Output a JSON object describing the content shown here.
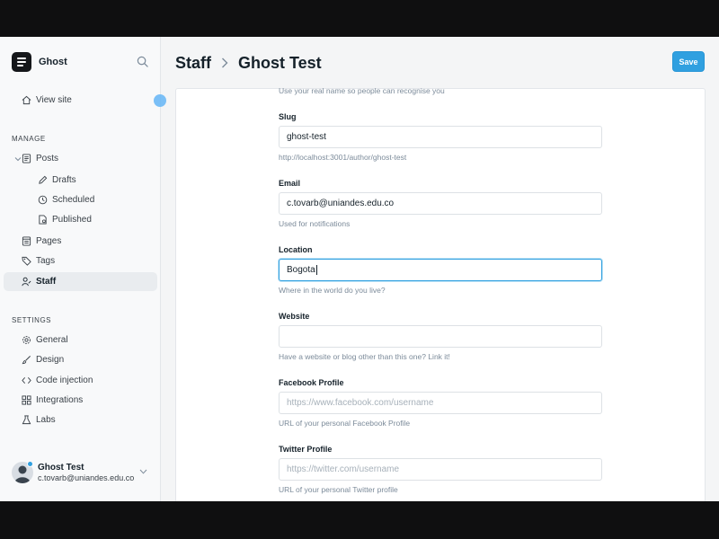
{
  "sidebar": {
    "brand": "Ghost",
    "view_site": "View site",
    "manage_heading": "MANAGE",
    "posts": "Posts",
    "drafts": "Drafts",
    "scheduled": "Scheduled",
    "published": "Published",
    "pages": "Pages",
    "tags": "Tags",
    "staff": "Staff",
    "settings_heading": "SETTINGS",
    "general": "General",
    "design": "Design",
    "code_injection": "Code injection",
    "integrations": "Integrations",
    "labs": "Labs",
    "user": {
      "name": "Ghost Test",
      "email": "c.tovarb@uniandes.edu.co"
    }
  },
  "header": {
    "breadcrumb_parent": "Staff",
    "breadcrumb_current": "Ghost Test",
    "save_label": "Save"
  },
  "form": {
    "name_hint": "Use your real name so people can recognise you",
    "slug": {
      "label": "Slug",
      "value": "ghost-test",
      "hint": "http://localhost:3001/author/ghost-test"
    },
    "email": {
      "label": "Email",
      "value": "c.tovarb@uniandes.edu.co",
      "hint": "Used for notifications"
    },
    "location": {
      "label": "Location",
      "value": "Bogota",
      "hint": "Where in the world do you live?"
    },
    "website": {
      "label": "Website",
      "value": "",
      "hint": "Have a website or blog other than this one? Link it!"
    },
    "facebook": {
      "label": "Facebook Profile",
      "placeholder": "https://www.facebook.com/username",
      "hint": "URL of your personal Facebook Profile"
    },
    "twitter": {
      "label": "Twitter Profile",
      "placeholder": "https://twitter.com/username",
      "hint": "URL of your personal Twitter profile"
    }
  },
  "colors": {
    "accent": "#30a0e0",
    "sidebar_bg": "#f8f9fa",
    "active_nav_bg": "#e9ecef"
  }
}
